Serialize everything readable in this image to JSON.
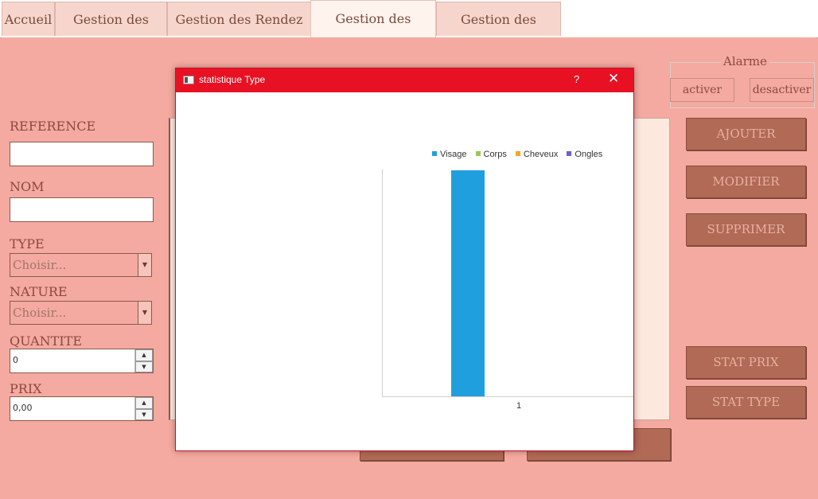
{
  "tabs": [
    {
      "label": "Accueil"
    },
    {
      "label": "Gestion des clients"
    },
    {
      "label": "Gestion des Rendez vous"
    },
    {
      "label": "Gestion des Produits"
    },
    {
      "label": "Gestion des employes"
    }
  ],
  "form": {
    "reference_label": "REFERENCE",
    "reference_value": "",
    "nom_label": "NOM",
    "nom_value": "",
    "type_label": "TYPE",
    "type_value": "Choisir...",
    "nature_label": "NATURE",
    "nature_value": "Choisir...",
    "quantite_label": "QUANTITE",
    "quantite_value": "0",
    "prix_label": "PRIX",
    "prix_value": "0,00"
  },
  "alarme": {
    "title": "Alarme",
    "activer": "activer",
    "desactiver": "desactiver"
  },
  "actions": {
    "ajouter": "AJOUTER",
    "modifier": "MODIFIER",
    "supprimer": "SUPPRIMER",
    "stat_prix": "STAT PRIX",
    "stat_type": "STAT TYPE"
  },
  "dialog": {
    "title": "statistique Type",
    "help": "?",
    "close": "✕"
  },
  "chart_data": {
    "type": "bar",
    "categories": [
      "1"
    ],
    "series": [
      {
        "name": "Visage",
        "values": [
          1
        ],
        "color": "#209fdf"
      },
      {
        "name": "Corps",
        "values": [
          0
        ],
        "color": "#99ca53"
      },
      {
        "name": "Cheveux",
        "values": [
          0
        ],
        "color": "#f6a625"
      },
      {
        "name": "Ongles",
        "values": [
          0
        ],
        "color": "#6d5fd5"
      }
    ],
    "ylim": [
      0,
      1
    ],
    "legend": "top",
    "grid": false
  }
}
